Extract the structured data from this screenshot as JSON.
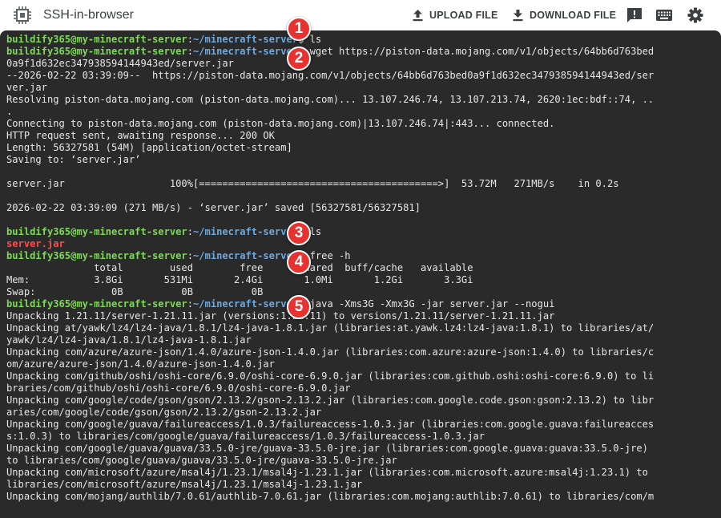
{
  "window": {
    "title": "SSH-in-browser",
    "app_icon": "chip-icon"
  },
  "toolbar": {
    "upload_label": "UPLOAD FILE",
    "download_label": "DOWNLOAD FILE",
    "icons": [
      "feedback-icon",
      "keyboard-icon",
      "gear-icon"
    ]
  },
  "colors": {
    "terminal_bg": "#2a2a2a",
    "prompt_user": "#7ed957",
    "prompt_path": "#6fa8dc",
    "error_text": "#ff4b4b",
    "badge": "#e8322f"
  },
  "badges": [
    "1",
    "2",
    "3",
    "4",
    "5"
  ],
  "terminal": {
    "prompt_user": "buildify365@my-minecraft-server",
    "prompt_sep": ":",
    "prompt_path": "~/minecraft-server",
    "prompt_end": "$ ",
    "lines": [
      {
        "prompt": true,
        "text": "ls"
      },
      {
        "prompt": true,
        "text": "wget https://piston-data.mojang.com/v1/objects/64bb6d763bed"
      },
      {
        "text": "0a9f1d632ec347938594144943ed/server.jar"
      },
      {
        "text": "--2026-02-22 03:39:09--  https://piston-data.mojang.com/v1/objects/64bb6d763bed0a9f1d632ec347938594144943ed/ser"
      },
      {
        "text": "ver.jar"
      },
      {
        "text": "Resolving piston-data.mojang.com (piston-data.mojang.com)... 13.107.246.74, 13.107.213.74, 2620:1ec:bdf::74, .."
      },
      {
        "text": "."
      },
      {
        "text": "Connecting to piston-data.mojang.com (piston-data.mojang.com)|13.107.246.74|:443... connected."
      },
      {
        "text": "HTTP request sent, awaiting response... 200 OK"
      },
      {
        "text": "Length: 56327581 (54M) [application/octet-stream]"
      },
      {
        "text": "Saving to: ‘server.jar’"
      },
      {
        "text": ""
      },
      {
        "text": "server.jar                  100%[=========================================>]  53.72M   271MB/s    in 0.2s"
      },
      {
        "text": ""
      },
      {
        "text": "2026-02-22 03:39:09 (271 MB/s) - ‘server.jar’ saved [56327581/56327581]"
      },
      {
        "text": ""
      },
      {
        "prompt": true,
        "text": "ls"
      },
      {
        "text": "server.jar",
        "error": true
      },
      {
        "prompt": true,
        "text": "free -h"
      },
      {
        "text": "               total        used        free      shared  buff/cache   available"
      },
      {
        "text": "Mem:           3.8Gi       531Mi       2.4Gi       1.0Mi       1.2Gi       3.3Gi"
      },
      {
        "text": "Swap:             0B          0B          0B"
      },
      {
        "prompt": true,
        "text": "java -Xms3G -Xmx3G -jar server.jar --nogui"
      },
      {
        "text": "Unpacking 1.21.11/server-1.21.11.jar (versions:1.21.11) to versions/1.21.11/server-1.21.11.jar"
      },
      {
        "text": "Unpacking at/yawk/lz4/lz4-java/1.8.1/lz4-java-1.8.1.jar (libraries:at.yawk.lz4:lz4-java:1.8.1) to libraries/at/"
      },
      {
        "text": "yawk/lz4/lz4-java/1.8.1/lz4-java-1.8.1.jar"
      },
      {
        "text": "Unpacking com/azure/azure-json/1.4.0/azure-json-1.4.0.jar (libraries:com.azure:azure-json:1.4.0) to libraries/c"
      },
      {
        "text": "om/azure/azure-json/1.4.0/azure-json-1.4.0.jar"
      },
      {
        "text": "Unpacking com/github/oshi/oshi-core/6.9.0/oshi-core-6.9.0.jar (libraries:com.github.oshi:oshi-core:6.9.0) to li"
      },
      {
        "text": "braries/com/github/oshi/oshi-core/6.9.0/oshi-core-6.9.0.jar"
      },
      {
        "text": "Unpacking com/google/code/gson/gson/2.13.2/gson-2.13.2.jar (libraries:com.google.code.gson:gson:2.13.2) to libr"
      },
      {
        "text": "aries/com/google/code/gson/gson/2.13.2/gson-2.13.2.jar"
      },
      {
        "text": "Unpacking com/google/guava/failureaccess/1.0.3/failureaccess-1.0.3.jar (libraries:com.google.guava:failureacces"
      },
      {
        "text": "s:1.0.3) to libraries/com/google/guava/failureaccess/1.0.3/failureaccess-1.0.3.jar"
      },
      {
        "text": "Unpacking com/google/guava/guava/33.5.0-jre/guava-33.5.0-jre.jar (libraries:com.google.guava:guava:33.5.0-jre)"
      },
      {
        "text": "to libraries/com/google/guava/guava/33.5.0-jre/guava-33.5.0-jre.jar"
      },
      {
        "text": "Unpacking com/microsoft/azure/msal4j/1.23.1/msal4j-1.23.1.jar (libraries:com.microsoft.azure:msal4j:1.23.1) to"
      },
      {
        "text": "libraries/com/microsoft/azure/msal4j/1.23.1/msal4j-1.23.1.jar"
      },
      {
        "text": "Unpacking com/mojang/authlib/7.0.61/authlib-7.0.61.jar (libraries:com.mojang:authlib:7.0.61) to libraries/com/m"
      }
    ]
  }
}
